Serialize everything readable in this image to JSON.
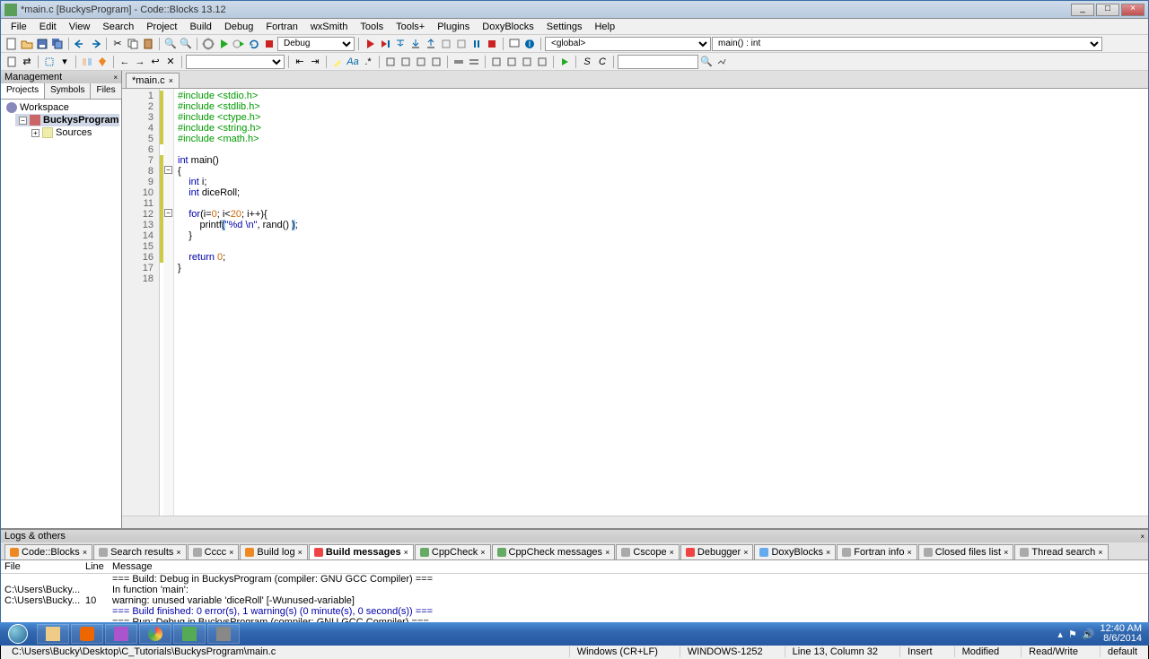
{
  "window": {
    "title": "*main.c [BuckysProgram] - Code::Blocks 13.12"
  },
  "menubar": [
    "File",
    "Edit",
    "View",
    "Search",
    "Project",
    "Build",
    "Debug",
    "Fortran",
    "wxSmith",
    "Tools",
    "Tools+",
    "Plugins",
    "DoxyBlocks",
    "Settings",
    "Help"
  ],
  "toolbar": {
    "build_target": "Debug",
    "scope": "<global>",
    "function": "main() : int"
  },
  "sidebar": {
    "title": "Management",
    "tabs": [
      "Projects",
      "Symbols",
      "Files"
    ],
    "tree": {
      "workspace": "Workspace",
      "project": "BuckysProgram",
      "sources": "Sources"
    }
  },
  "editor": {
    "tab": "*main.c",
    "lines": [
      {
        "n": 1,
        "html": "<span class='kw-inc'>#include &lt;stdio.h&gt;</span>"
      },
      {
        "n": 2,
        "html": "<span class='kw-inc'>#include &lt;stdlib.h&gt;</span>"
      },
      {
        "n": 3,
        "html": "<span class='kw-inc'>#include &lt;ctype.h&gt;</span>"
      },
      {
        "n": 4,
        "html": "<span class='kw-inc'>#include &lt;string.h&gt;</span>"
      },
      {
        "n": 5,
        "html": "<span class='kw-inc'>#include &lt;math.h&gt;</span>"
      },
      {
        "n": 6,
        "html": ""
      },
      {
        "n": 7,
        "html": "<span class='kw-type'>int</span> main()"
      },
      {
        "n": 8,
        "html": "{"
      },
      {
        "n": 9,
        "html": "    <span class='kw-type'>int</span> i;"
      },
      {
        "n": 10,
        "html": "    <span class='kw-type'>int</span> diceRoll;"
      },
      {
        "n": 11,
        "html": ""
      },
      {
        "n": 12,
        "html": "    <span class='kw-key'>for</span>(i=<span style='color:#c60'>0</span>; i&lt;<span style='color:#c60'>20</span>; i++){"
      },
      {
        "n": 13,
        "html": "        printf<span class='hl-paren'>(</span><span class='kw-str'>\"%d \\n\"</span>, rand() <span class='hl-paren'>)</span>;"
      },
      {
        "n": 14,
        "html": "    }"
      },
      {
        "n": 15,
        "html": ""
      },
      {
        "n": 16,
        "html": "    <span class='kw-key'>return</span> <span style='color:#c60'>0</span>;"
      },
      {
        "n": 17,
        "html": "}"
      },
      {
        "n": 18,
        "html": ""
      }
    ]
  },
  "logs": {
    "title": "Logs & others",
    "tabs": [
      "Code::Blocks",
      "Search results",
      "Cccc",
      "Build log",
      "Build messages",
      "CppCheck",
      "CppCheck messages",
      "Cscope",
      "Debugger",
      "DoxyBlocks",
      "Fortran info",
      "Closed files list",
      "Thread search"
    ],
    "active_tab": 4,
    "headers": {
      "file": "File",
      "line": "Line",
      "msg": "Message"
    },
    "rows": [
      {
        "file": "",
        "line": "",
        "msg": "=== Build: Debug in BuckysProgram (compiler: GNU GCC Compiler) ===",
        "cls": ""
      },
      {
        "file": "C:\\Users\\Bucky...",
        "line": "",
        "msg": "In function 'main':",
        "cls": ""
      },
      {
        "file": "C:\\Users\\Bucky...",
        "line": "10",
        "msg": "warning: unused variable 'diceRoll' [-Wunused-variable]",
        "cls": ""
      },
      {
        "file": "",
        "line": "",
        "msg": "=== Build finished: 0 error(s), 1 warning(s) (0 minute(s), 0 second(s)) ===",
        "cls": "msg-blue"
      },
      {
        "file": "",
        "line": "",
        "msg": "=== Run: Debug in BuckysProgram (compiler: GNU GCC Compiler) ===",
        "cls": ""
      }
    ]
  },
  "statusbar": {
    "path": "C:\\Users\\Bucky\\Desktop\\C_Tutorials\\BuckysProgram\\main.c",
    "eol": "Windows (CR+LF)",
    "encoding": "WINDOWS-1252",
    "pos": "Line 13, Column 32",
    "insert": "Insert",
    "modified": "Modified",
    "rw": "Read/Write",
    "profile": "default"
  },
  "tray": {
    "time": "12:40 AM",
    "date": "8/6/2014"
  }
}
